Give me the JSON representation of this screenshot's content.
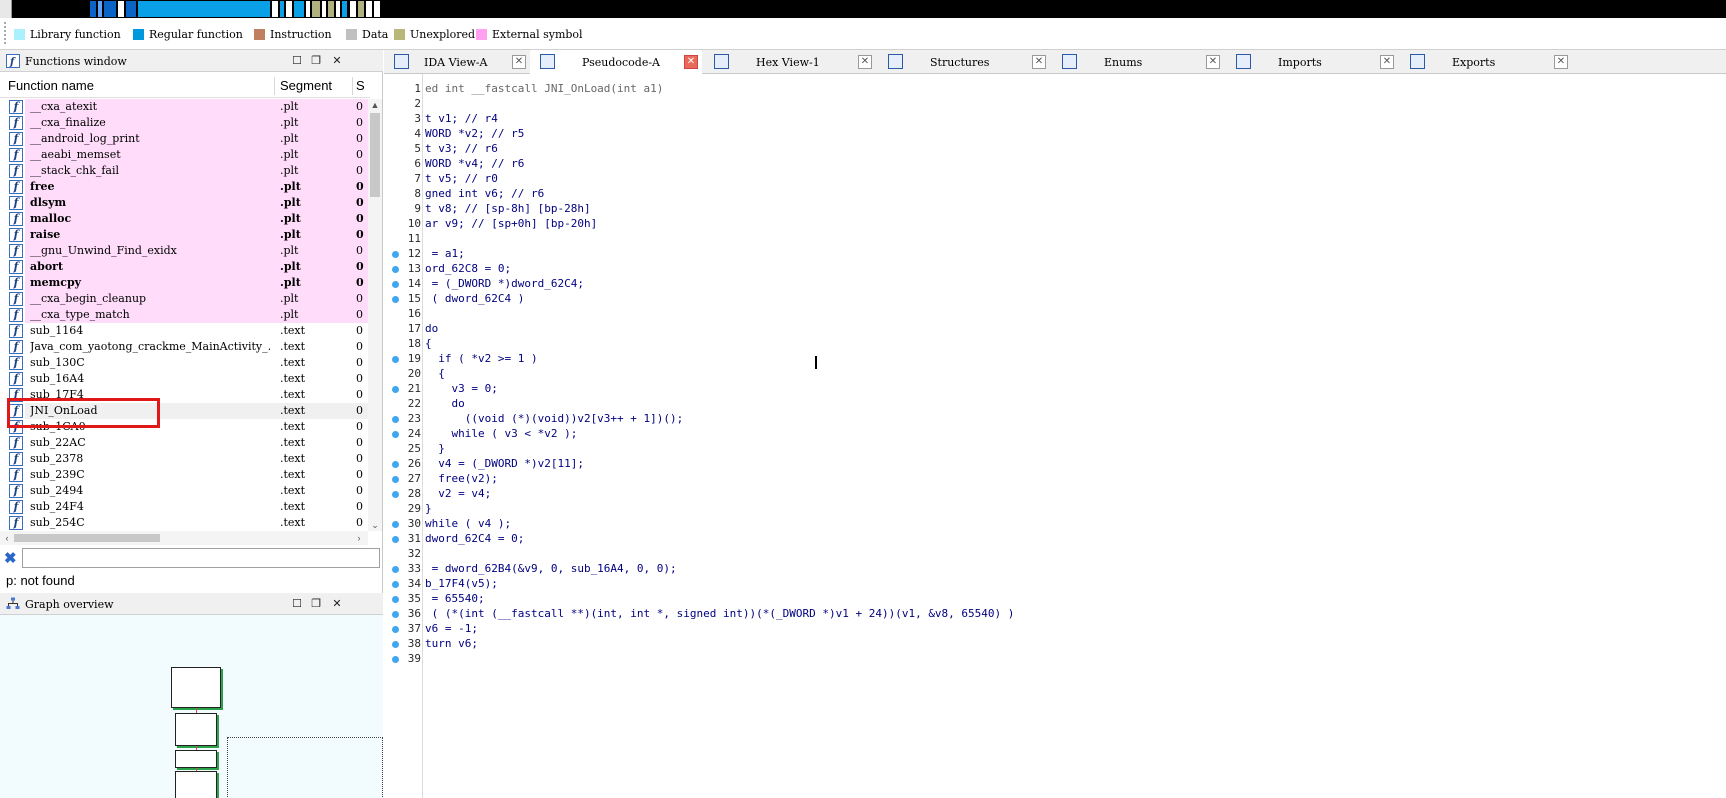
{
  "legend": [
    {
      "label": "Library function",
      "color": "#aaf0ff"
    },
    {
      "label": "Regular function",
      "color": "#0099dd"
    },
    {
      "label": "Instruction",
      "color": "#c08060"
    },
    {
      "label": "Data",
      "color": "#c0c0c0"
    },
    {
      "label": "Unexplored",
      "color": "#b8b878"
    },
    {
      "label": "External symbol",
      "color": "#ffa0f0"
    }
  ],
  "functions_window": {
    "title": "Functions window",
    "columns": {
      "name": "Function name",
      "segment": "Segment",
      "start": "S"
    },
    "rows": [
      {
        "name": "__cxa_atexit",
        "segment": ".plt",
        "start": "0",
        "bold": false,
        "bg": "#ffddfa"
      },
      {
        "name": "__cxa_finalize",
        "segment": ".plt",
        "start": "0",
        "bold": false,
        "bg": "#ffddfa"
      },
      {
        "name": "__android_log_print",
        "segment": ".plt",
        "start": "0",
        "bold": false,
        "bg": "#ffddfa"
      },
      {
        "name": "__aeabi_memset",
        "segment": ".plt",
        "start": "0",
        "bold": false,
        "bg": "#ffddfa"
      },
      {
        "name": "__stack_chk_fail",
        "segment": ".plt",
        "start": "0",
        "bold": false,
        "bg": "#ffddfa"
      },
      {
        "name": "free",
        "segment": ".plt",
        "start": "0",
        "bold": true,
        "bg": "#ffddfa"
      },
      {
        "name": "dlsym",
        "segment": ".plt",
        "start": "0",
        "bold": true,
        "bg": "#ffddfa"
      },
      {
        "name": "malloc",
        "segment": ".plt",
        "start": "0",
        "bold": true,
        "bg": "#ffddfa"
      },
      {
        "name": "raise",
        "segment": ".plt",
        "start": "0",
        "bold": true,
        "bg": "#ffddfa"
      },
      {
        "name": "__gnu_Unwind_Find_exidx",
        "segment": ".plt",
        "start": "0",
        "bold": false,
        "bg": "#ffddfa"
      },
      {
        "name": "abort",
        "segment": ".plt",
        "start": "0",
        "bold": true,
        "bg": "#ffddfa"
      },
      {
        "name": "memcpy",
        "segment": ".plt",
        "start": "0",
        "bold": true,
        "bg": "#ffddfa"
      },
      {
        "name": "__cxa_begin_cleanup",
        "segment": ".plt",
        "start": "0",
        "bold": false,
        "bg": "#ffddfa"
      },
      {
        "name": "__cxa_type_match",
        "segment": ".plt",
        "start": "0",
        "bold": false,
        "bg": "#ffddfa"
      },
      {
        "name": "sub_1164",
        "segment": ".text",
        "start": "0",
        "bold": false,
        "bg": "#ffffff"
      },
      {
        "name": "Java_com_yaotong_crackme_MainActivity_…",
        "segment": ".text",
        "start": "0",
        "bold": false,
        "bg": "#ffffff"
      },
      {
        "name": "sub_130C",
        "segment": ".text",
        "start": "0",
        "bold": false,
        "bg": "#ffffff"
      },
      {
        "name": "sub_16A4",
        "segment": ".text",
        "start": "0",
        "bold": false,
        "bg": "#ffffff"
      },
      {
        "name": "sub_17F4",
        "segment": ".text",
        "start": "0",
        "bold": false,
        "bg": "#ffffff"
      },
      {
        "name": "JNI_OnLoad",
        "segment": ".text",
        "start": "0",
        "bold": false,
        "bg": "#f0f0f0"
      },
      {
        "name": "sub_1CA0",
        "segment": ".text",
        "start": "0",
        "bold": false,
        "bg": "#ffffff"
      },
      {
        "name": "sub_22AC",
        "segment": ".text",
        "start": "0",
        "bold": false,
        "bg": "#ffffff"
      },
      {
        "name": "sub_2378",
        "segment": ".text",
        "start": "0",
        "bold": false,
        "bg": "#ffffff"
      },
      {
        "name": "sub_239C",
        "segment": ".text",
        "start": "0",
        "bold": false,
        "bg": "#ffffff"
      },
      {
        "name": "sub_2494",
        "segment": ".text",
        "start": "0",
        "bold": false,
        "bg": "#ffffff"
      },
      {
        "name": "sub_24F4",
        "segment": ".text",
        "start": "0",
        "bold": false,
        "bg": "#ffffff"
      },
      {
        "name": "sub_254C",
        "segment": ".text",
        "start": "0",
        "bold": false,
        "bg": "#ffffff"
      }
    ]
  },
  "status_text": "p: not found",
  "graph_overview": {
    "title": "Graph overview"
  },
  "tabs": [
    {
      "label": "IDA View-A",
      "icon": "ida-view-icon",
      "active": false
    },
    {
      "label": "Pseudocode-A",
      "icon": "pseudocode-icon",
      "active": true
    },
    {
      "label": "Hex View-1",
      "icon": "hex-view-icon",
      "active": false
    },
    {
      "label": "Structures",
      "icon": "structures-icon",
      "active": false
    },
    {
      "label": "Enums",
      "icon": "enums-icon",
      "active": false
    },
    {
      "label": "Imports",
      "icon": "imports-icon",
      "active": false
    },
    {
      "label": "Exports",
      "icon": "exports-icon",
      "active": false
    }
  ],
  "code_lines": [
    {
      "n": "1",
      "dot": false,
      "text": "ed int __fastcall JNI_OnLoad(int a1)",
      "color": "#666666"
    },
    {
      "n": "2",
      "dot": false,
      "text": "",
      "color": "#000080"
    },
    {
      "n": "3",
      "dot": false,
      "text": "t v1; // r4",
      "color": "#000080"
    },
    {
      "n": "4",
      "dot": false,
      "text": "WORD *v2; // r5",
      "color": "#000080"
    },
    {
      "n": "5",
      "dot": false,
      "text": "t v3; // r6",
      "color": "#000080"
    },
    {
      "n": "6",
      "dot": false,
      "text": "WORD *v4; // r6",
      "color": "#000080"
    },
    {
      "n": "7",
      "dot": false,
      "text": "t v5; // r0",
      "color": "#000080"
    },
    {
      "n": "8",
      "dot": false,
      "text": "gned int v6; // r6",
      "color": "#000080"
    },
    {
      "n": "9",
      "dot": false,
      "text": "t v8; // [sp-8h] [bp-28h]",
      "color": "#000080"
    },
    {
      "n": "10",
      "dot": false,
      "text": "ar v9; // [sp+0h] [bp-20h]",
      "color": "#000080"
    },
    {
      "n": "11",
      "dot": false,
      "text": "",
      "color": "#000080"
    },
    {
      "n": "12",
      "dot": true,
      "text": " = a1;",
      "color": "#000080"
    },
    {
      "n": "13",
      "dot": true,
      "text": "ord_62C8 = 0;",
      "color": "#000080"
    },
    {
      "n": "14",
      "dot": true,
      "text": " = (_DWORD *)dword_62C4;",
      "color": "#000080"
    },
    {
      "n": "15",
      "dot": true,
      "text": " ( dword_62C4 )",
      "color": "#000080"
    },
    {
      "n": "16",
      "dot": false,
      "text": "",
      "color": "#000080"
    },
    {
      "n": "17",
      "dot": false,
      "text": "do",
      "color": "#000080"
    },
    {
      "n": "18",
      "dot": false,
      "text": "{",
      "color": "#000080"
    },
    {
      "n": "19",
      "dot": true,
      "text": "  if ( *v2 >= 1 )",
      "color": "#000080"
    },
    {
      "n": "20",
      "dot": false,
      "text": "  {",
      "color": "#000080"
    },
    {
      "n": "21",
      "dot": true,
      "text": "    v3 = 0;",
      "color": "#000080"
    },
    {
      "n": "22",
      "dot": false,
      "text": "    do",
      "color": "#000080"
    },
    {
      "n": "23",
      "dot": true,
      "text": "      ((void (*)(void))v2[v3++ + 1])();",
      "color": "#000080"
    },
    {
      "n": "24",
      "dot": true,
      "text": "    while ( v3 < *v2 );",
      "color": "#000080"
    },
    {
      "n": "25",
      "dot": false,
      "text": "  }",
      "color": "#000080"
    },
    {
      "n": "26",
      "dot": true,
      "text": "  v4 = (_DWORD *)v2[11];",
      "color": "#000080"
    },
    {
      "n": "27",
      "dot": true,
      "text": "  free(v2);",
      "color": "#000080"
    },
    {
      "n": "28",
      "dot": true,
      "text": "  v2 = v4;",
      "color": "#000080"
    },
    {
      "n": "29",
      "dot": false,
      "text": "}",
      "color": "#000080"
    },
    {
      "n": "30",
      "dot": true,
      "text": "while ( v4 );",
      "color": "#000080"
    },
    {
      "n": "31",
      "dot": true,
      "text": "dword_62C4 = 0;",
      "color": "#000080"
    },
    {
      "n": "32",
      "dot": false,
      "text": "",
      "color": "#000080"
    },
    {
      "n": "33",
      "dot": true,
      "text": " = dword_62B4(&v9, 0, sub_16A4, 0, 0);",
      "color": "#000080"
    },
    {
      "n": "34",
      "dot": true,
      "text": "b_17F4(v5);",
      "color": "#000080"
    },
    {
      "n": "35",
      "dot": true,
      "text": " = 65540;",
      "color": "#000080"
    },
    {
      "n": "36",
      "dot": true,
      "text": " ( (*(int (__fastcall **)(int, int *, signed int))(*(_DWORD *)v1 + 24))(v1, &v8, 65540) )",
      "color": "#000080"
    },
    {
      "n": "37",
      "dot": true,
      "text": "v6 = -1;",
      "color": "#000080"
    },
    {
      "n": "38",
      "dot": true,
      "text": "turn v6;",
      "color": "#000080"
    },
    {
      "n": "39",
      "dot": true,
      "text": "",
      "color": "#000080"
    }
  ]
}
